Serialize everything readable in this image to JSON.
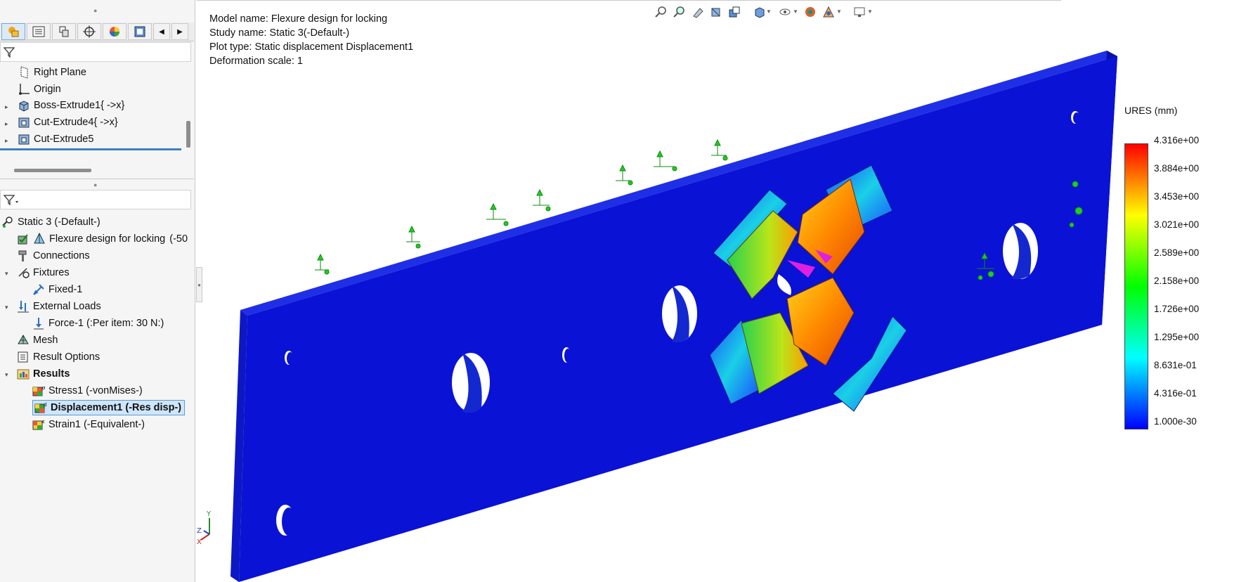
{
  "feature_tree": {
    "items": [
      {
        "label": "Right Plane"
      },
      {
        "label": "Origin"
      },
      {
        "label": "Boss-Extrude1{ ->x}"
      },
      {
        "label": "Cut-Extrude4{ ->x}"
      },
      {
        "label": "Cut-Extrude5"
      }
    ]
  },
  "sim_tree": {
    "study": "Static 3 (-Default-)",
    "part": "Flexure design for locking",
    "part_suffix": "(-50",
    "connections": "Connections",
    "fixtures": "Fixtures",
    "fixed": "Fixed-1",
    "external_loads": "External Loads",
    "force": "Force-1 (:Per item: 30 N:)",
    "mesh": "Mesh",
    "result_options": "Result Options",
    "results": "Results",
    "stress": "Stress1 (-vonMises-)",
    "displacement": "Displacement1 (-Res disp-)",
    "strain": "Strain1 (-Equivalent-)"
  },
  "plot_info": {
    "model": "Model name: Flexure design for locking",
    "study": "Study name: Static 3(-Default-)",
    "plot_type": "Plot type: Static displacement Displacement1",
    "scale": "Deformation scale: 1"
  },
  "legend": {
    "title": "URES (mm)",
    "values": [
      "4.316e+00",
      "3.884e+00",
      "3.453e+00",
      "3.021e+00",
      "2.589e+00",
      "2.158e+00",
      "1.726e+00",
      "1.295e+00",
      "8.631e-01",
      "4.316e-01",
      "1.000e-30"
    ],
    "colors": [
      "#ff0000",
      "#ffff00",
      "#00ff00",
      "#00ffff",
      "#0000ff"
    ]
  },
  "triad": {
    "z": "Z",
    "y": "Y",
    "x": "X"
  },
  "toolbar_icons": [
    "zoom-to-fit-icon",
    "zoom-area-icon",
    "previous-view-icon",
    "section-view-icon",
    "view-orientation-icon",
    "display-style-icon",
    "hide-show-icon",
    "edit-appearance-icon",
    "apply-scene-icon",
    "view-settings-icon"
  ],
  "colors": {
    "plate": "#0a12d6",
    "selection": "#cfe5fb",
    "load_arrow": "#22cc22"
  }
}
